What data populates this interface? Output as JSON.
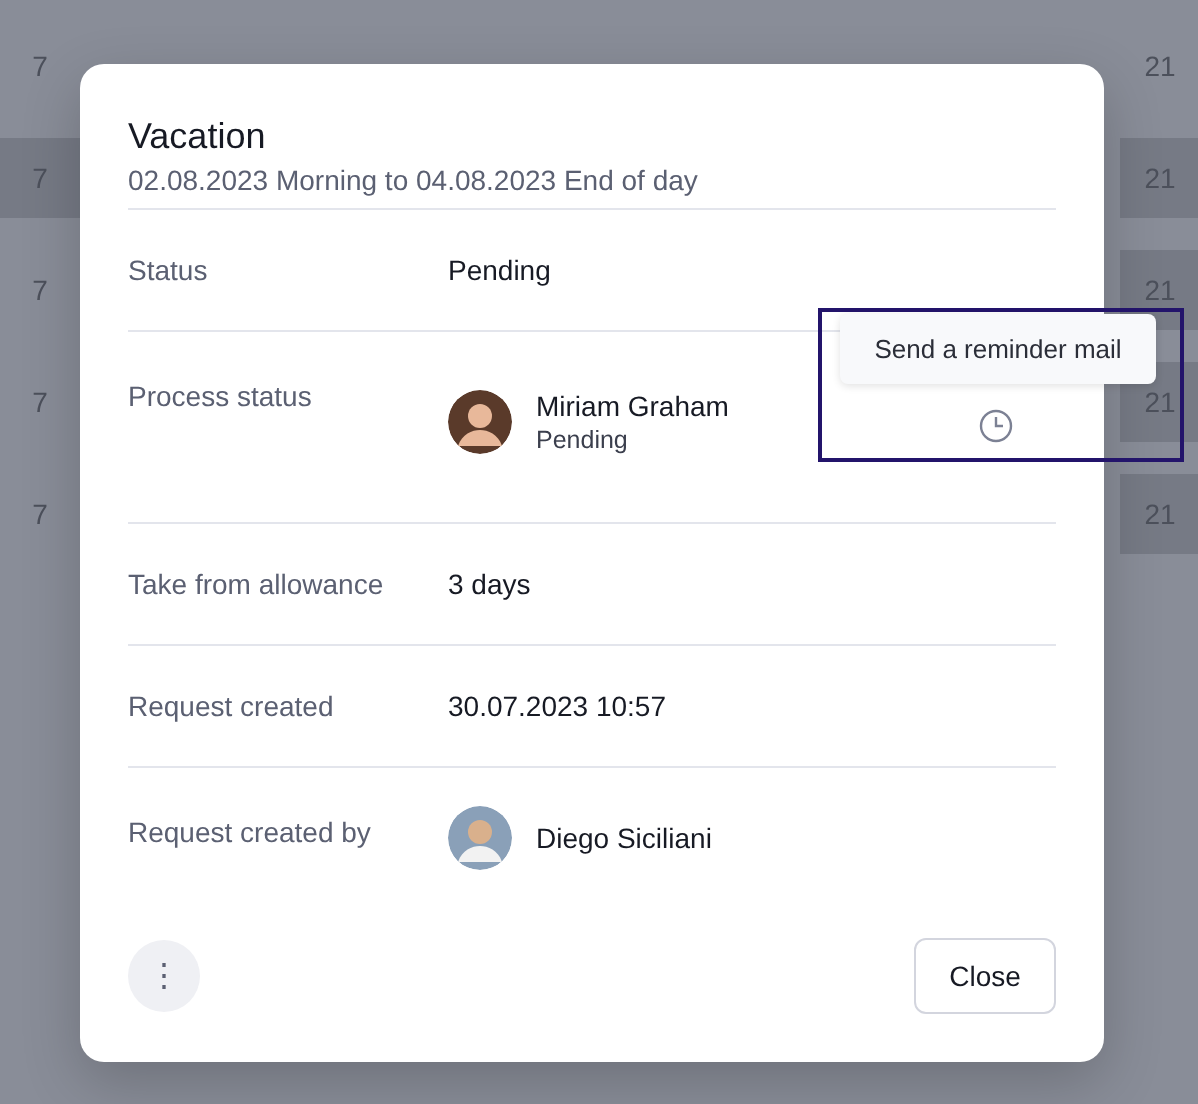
{
  "background_calendar": {
    "rows": [
      {
        "cells": [
          {
            "day": "7",
            "shaded": false
          },
          {
            "day": "21",
            "shaded": false
          }
        ]
      },
      {
        "cells": [
          {
            "day": "7",
            "shaded": true
          },
          {
            "day": "21",
            "shaded": true
          }
        ]
      },
      {
        "cells": [
          {
            "day": "7",
            "shaded": false
          },
          {
            "day": "21",
            "shaded": true
          }
        ]
      },
      {
        "cells": [
          {
            "day": "7",
            "shaded": false
          },
          {
            "day": "21",
            "shaded": true
          }
        ]
      },
      {
        "cells": [
          {
            "day": "7",
            "shaded": false
          },
          {
            "day": "21",
            "shaded": true
          }
        ]
      }
    ]
  },
  "dialog": {
    "title": "Vacation",
    "subtitle": "02.08.2023 Morning to 04.08.2023 End of day",
    "fields": [
      {
        "kind": "text",
        "label": "Status",
        "value": "Pending"
      },
      {
        "kind": "person",
        "label": "Process status",
        "person": {
          "name": "Miriam Graham",
          "status": "Pending"
        },
        "action": {
          "tooltip": "Send a reminder mail",
          "highlighted": true
        }
      },
      {
        "kind": "text",
        "label": "Take from allowance",
        "value": "3 days"
      },
      {
        "kind": "text",
        "label": "Request created",
        "value": "30.07.2023 10:57"
      },
      {
        "kind": "person",
        "label": "Request created by",
        "person": {
          "name": "Diego Siciliani"
        }
      }
    ],
    "more_button": "⋮",
    "close_button": "Close"
  }
}
